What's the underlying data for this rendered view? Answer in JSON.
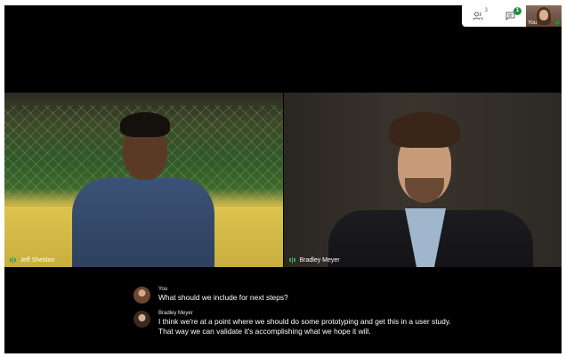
{
  "topbar": {
    "participants_icon": "people-icon",
    "participant_count": "3",
    "chat_icon": "chat-icon",
    "chat_badge": "1",
    "self_label": "You"
  },
  "tiles": [
    {
      "name": "Jeff Sheldon",
      "mic_icon": "audio-level-icon"
    },
    {
      "name": "Bradley Meyer",
      "mic_icon": "audio-level-icon"
    }
  ],
  "captions": [
    {
      "speaker": "You",
      "text": "What should we include for next steps?"
    },
    {
      "speaker": "Bradley Meyer",
      "text": "I think we're at a point where we should do some prototyping and get this in a user study. That way we can validate it's accomplishing what we hope it will."
    }
  ],
  "colors": {
    "accent_green": "#34a853",
    "badge_green": "#1e8e3e",
    "stage_bg": "#000000"
  }
}
